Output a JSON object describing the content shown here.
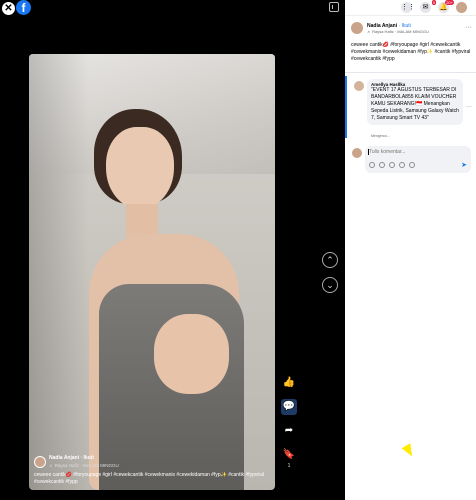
{
  "viewer": {
    "close_symbol": "✕",
    "logo_letter": "f",
    "nav_up": "⌃",
    "nav_down": "⌄"
  },
  "video": {
    "caption_name": "Nadia Anjani",
    "caption_follow": "· Ikuti",
    "caption_sub": "♬ Raysa Hafiz · MALAM MINGGU",
    "caption_text": "ceweee cantik💋 #foryoupage #girl #cewekcantik #cewekmanis #cewekidaman #fyp✨ #cantik #fypviral #cewekcantik #fypp"
  },
  "actions": {
    "like_icon": "👍",
    "comment_icon": "💬",
    "share_icon": "➦",
    "save_icon": "🔖",
    "save_count": "1"
  },
  "panel": {
    "topbar": {
      "menu_icon": "⋮⋮",
      "messenger_badge": "9",
      "notif_badge": "20+"
    },
    "post": {
      "author": "Nadia Anjani",
      "follow": "· Ikuti",
      "sub": "♬ Raysa Hafiz · MALAM MINGGU",
      "more": "···",
      "text": "ceweee cantik💋 #foryoupage #girl #cewekcantik #cewekmanis #cewekidaman #fyp✨ #cantik #fypviral #cewekcantik #fypp"
    },
    "comment": {
      "author": "Amellya Hasllka",
      "text": "\"EVENT 17 AGUSTUS TERBESAR DI BANDARBOLA855 KLAIM VOUCHER KAMU SEKARANG!🇮🇩 Menangkan Sepeda Listrik, Samsung Galaxy Watch 7, Samsung Smart TV 43\"",
      "meta": "Mengeroo...",
      "more": "···"
    },
    "compose": {
      "placeholder": "Tulis komentar...",
      "send_icon": "➤"
    }
  },
  "colors": {
    "facebook_blue": "#1877f2",
    "badge_red": "#e41e3f"
  }
}
